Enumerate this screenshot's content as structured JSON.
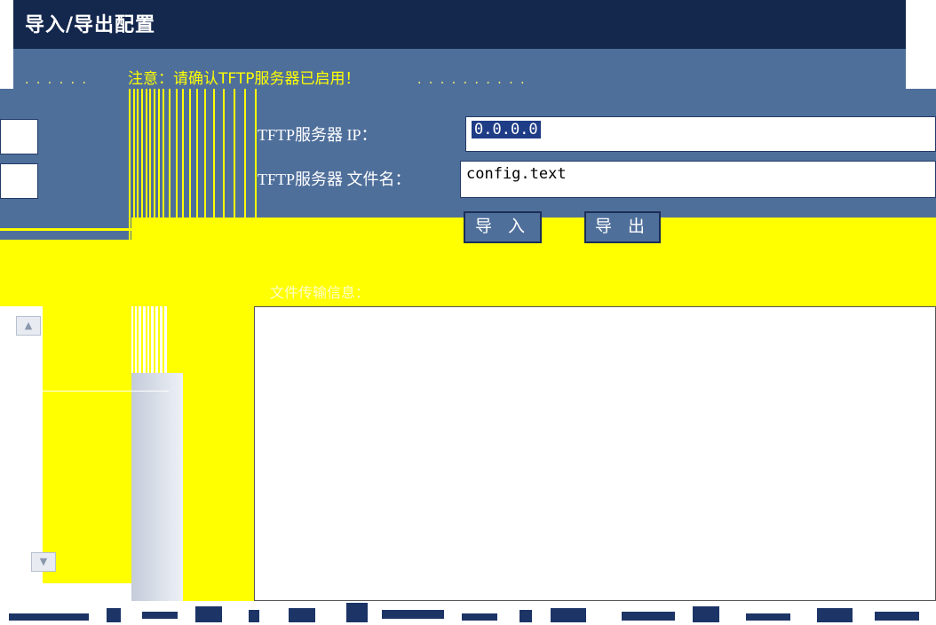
{
  "page": {
    "title": "导入/导出配置",
    "notice": "注意：请确认TFTP服务器已启用！"
  },
  "form": {
    "server_ip_label": "TFTP服务器 IP：",
    "server_ip_value": "0.0.0.0",
    "file_name_label": "TFTP服务器 文件名：",
    "file_name_value": "config.text",
    "import_button": "导 入",
    "export_button": "导 出"
  },
  "transfer_info": {
    "label": "文件传输信息：",
    "content": ""
  },
  "scrollbar": {
    "up_icon": "chevron-up-icon",
    "down_icon": "chevron-down-icon"
  },
  "colors": {
    "title_bar": "#14284e",
    "panel": "#4f6f9b",
    "glitch_yellow": "#ffff00",
    "selection": "#1f3d87"
  }
}
